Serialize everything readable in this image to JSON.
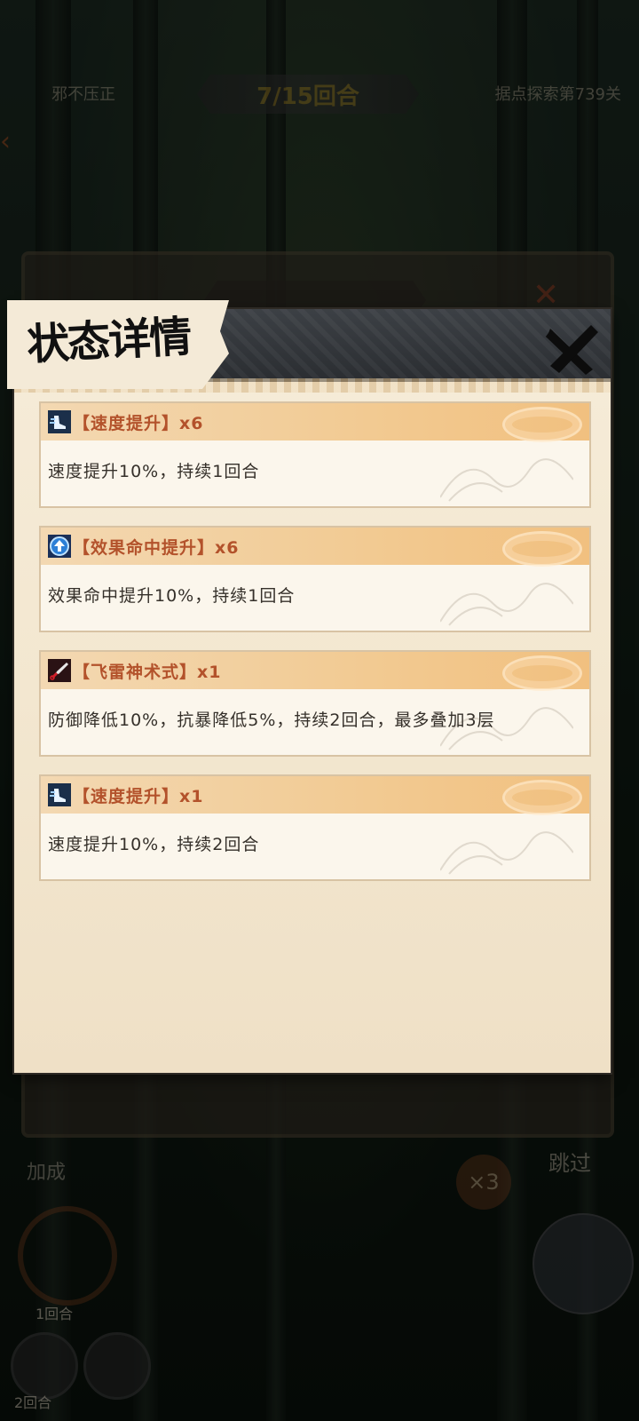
{
  "background": {
    "top_left_label": "邪不压正",
    "round_banner": "7/15回合",
    "top_right_label": "据点探索第739关",
    "cheng_label": "加成",
    "skip_label": "跳过",
    "speed_multiplier": "×3",
    "cooldown_label_1": "1回合",
    "cooldown_label_2": "2回合"
  },
  "dialog": {
    "title": "状态详情",
    "close_icon": "close-x-icon",
    "effects": [
      {
        "icon": "speed-boot-icon",
        "title": "【速度提升】x6",
        "desc": "速度提升10%，持续1回合"
      },
      {
        "icon": "hit-up-arrow-icon",
        "title": "【效果命中提升】x6",
        "desc": "效果命中提升10%，持续1回合"
      },
      {
        "icon": "kunai-icon",
        "title": "【飞雷神术式】x1",
        "desc": "防御降低10%，抗暴降低5%，持续2回合，最多叠加3层"
      },
      {
        "icon": "speed-boot-icon",
        "title": "【速度提升】x1",
        "desc": "速度提升10%，持续2回合"
      }
    ]
  },
  "colors": {
    "accent_title": "#b3522b",
    "card_header": "#f2ca92",
    "panel_bg": "#f3e7d0",
    "header_dark": "#2b2e32"
  }
}
